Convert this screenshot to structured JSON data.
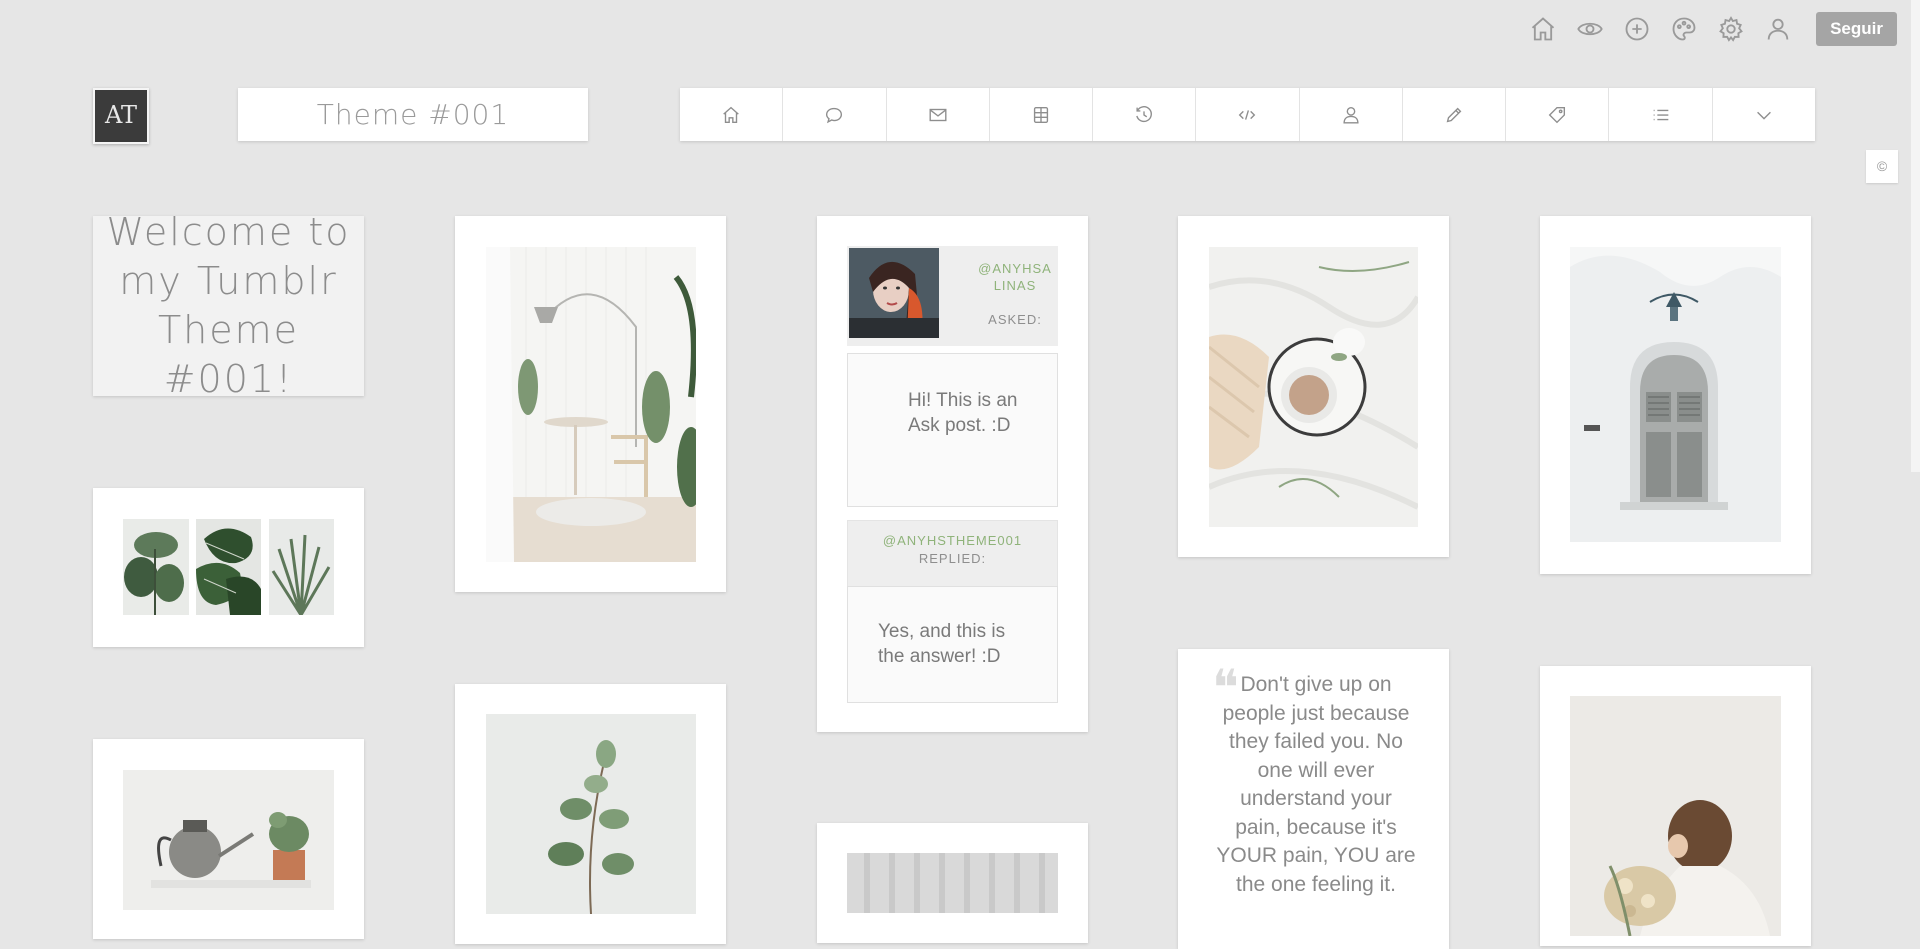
{
  "topbar": {
    "icons": [
      "home-icon",
      "eye-icon",
      "plus-circle-icon",
      "palette-icon",
      "gear-icon",
      "user-icon"
    ],
    "follow_label": "Seguir"
  },
  "header": {
    "logo_text": "AT",
    "title": "Theme #001",
    "nav_icons": [
      "home-icon",
      "chat-bubble-icon",
      "mail-icon",
      "archive-icon",
      "history-icon",
      "code-icon",
      "user-icon",
      "pencil-icon",
      "tag-icon",
      "list-icon",
      "chevron-down-icon"
    ]
  },
  "copyright_symbol": "©",
  "welcome": {
    "text": "Welcome to my Tumblr Theme #001!"
  },
  "ask": {
    "asker": "@ANYHSALINAS",
    "asked_label": "ASKED:",
    "question": "Hi! This is an Ask post. :D",
    "replier": "@ANYHSTHEME001",
    "replied_label": "REPLIED:",
    "answer": "Yes, and this is the answer! :D"
  },
  "quote": {
    "mark": "❝",
    "text": "Don't give up on people just because they failed you. No one will ever understand your pain, because it's YOUR pain, YOU are the one feeling it."
  }
}
